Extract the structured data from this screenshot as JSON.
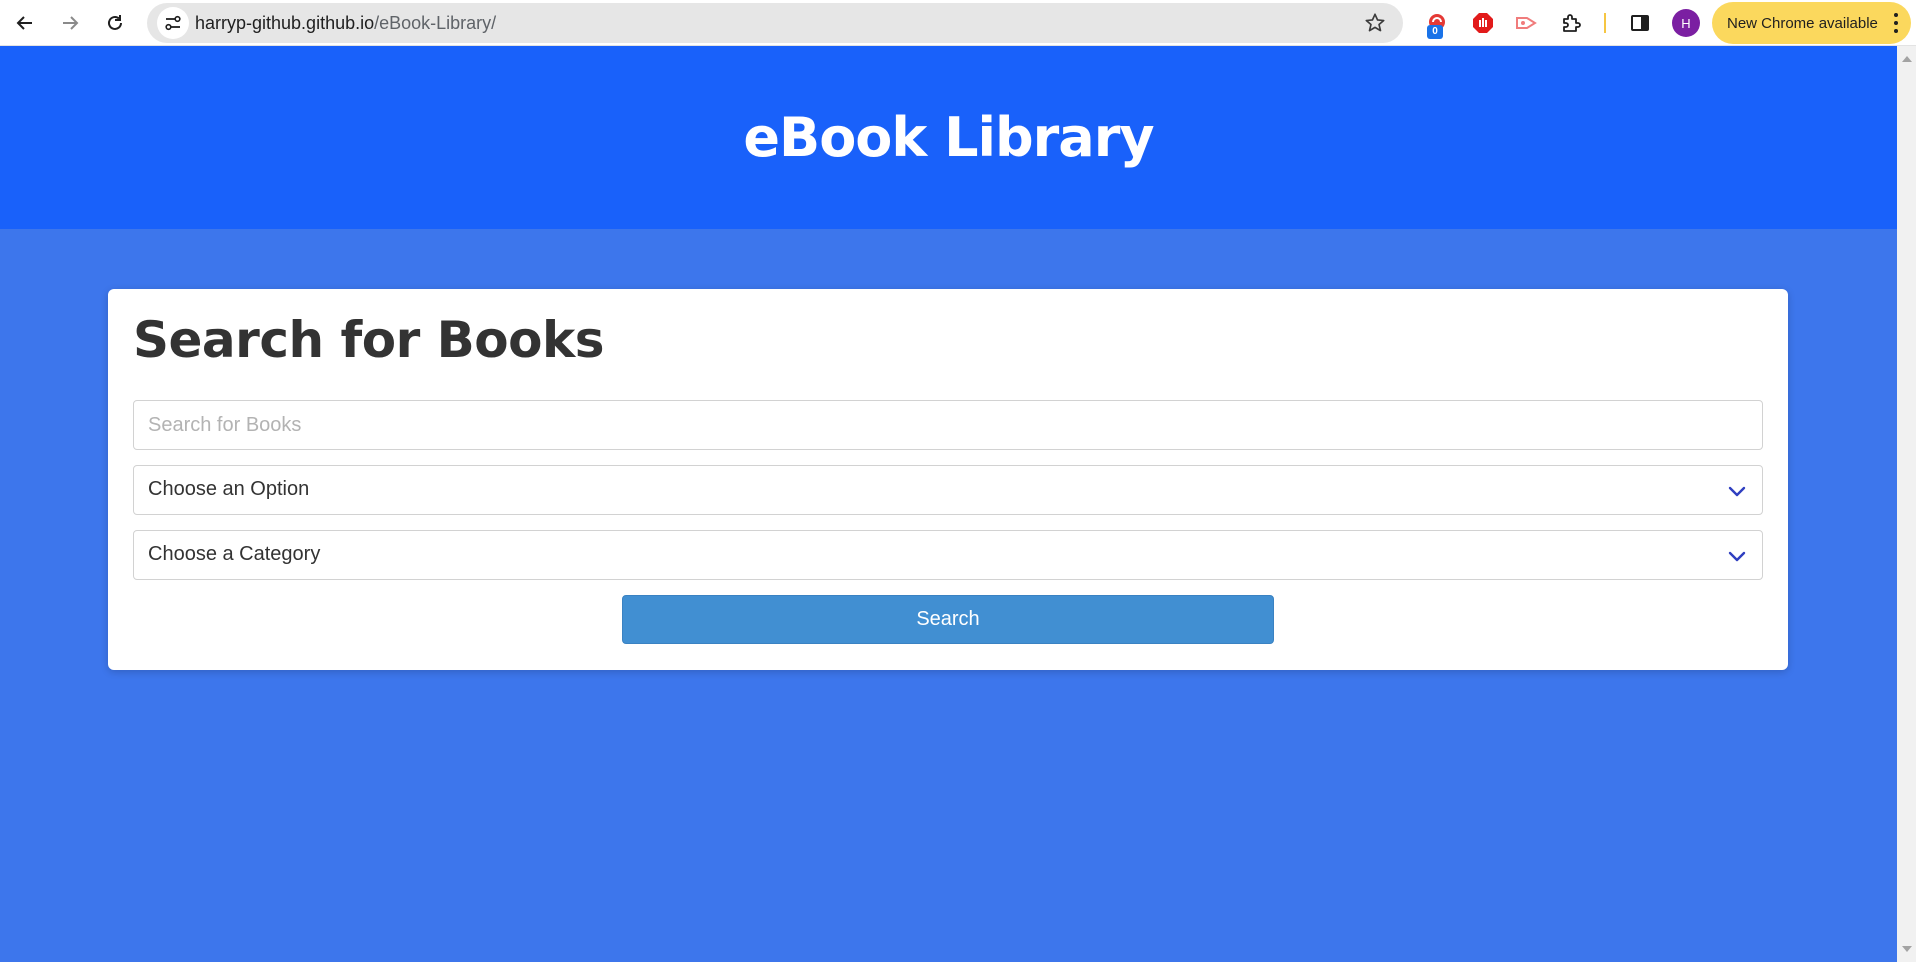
{
  "browser": {
    "url_host": "harryp-github.github.io",
    "url_path": "/eBook-Library/",
    "extension_badge_count": "0",
    "profile_initial": "H",
    "update_chip_label": "New Chrome available",
    "icons": [
      "back-arrow-icon",
      "forward-arrow-icon",
      "reload-icon",
      "site-info-icon",
      "bookmark-star-icon",
      "extension-ext1-icon",
      "extension-ext2-icon",
      "extension-ext3-icon",
      "extensions-puzzle-icon",
      "side-panel-icon",
      "more-vert-icon"
    ]
  },
  "header": {
    "title": "eBook Library"
  },
  "search_card": {
    "heading": "Search for Books",
    "search_placeholder": "Search for Books",
    "option_select_value": "Choose an Option",
    "category_select_value": "Choose a Category",
    "search_button_label": "Search"
  },
  "colors": {
    "header_bg": "#1961fa",
    "page_bg": "#3d76ec",
    "button_bg": "#418fd2",
    "chip_bg": "#fbd85d"
  }
}
